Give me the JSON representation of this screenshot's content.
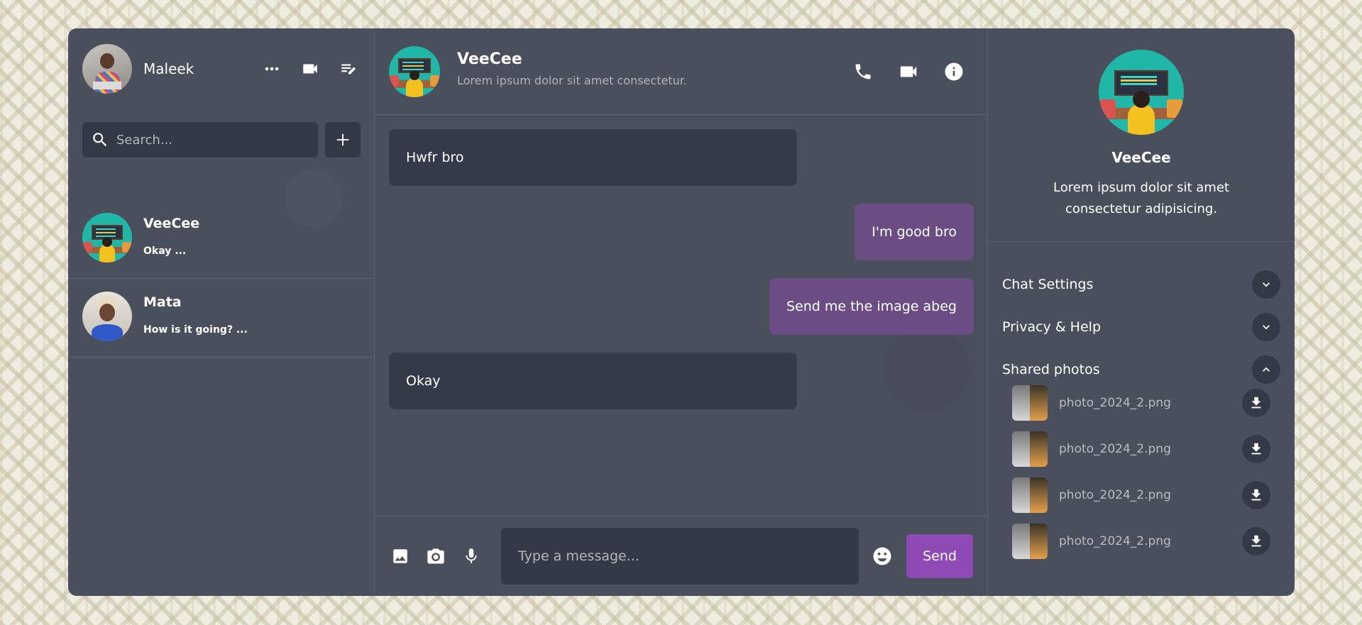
{
  "sidebar": {
    "user": {
      "name": "Maleek",
      "avatar": "maleek-avatar"
    },
    "header_icons": [
      "more-icon",
      "video-icon",
      "edit-icon"
    ],
    "search": {
      "placeholder": "Search...",
      "value": ""
    },
    "conversations": [
      {
        "name": "VeeCee",
        "last_message": "Okay ...",
        "avatar": "veecee-avatar"
      },
      {
        "name": "Mata",
        "last_message": "How is it going? ...",
        "avatar": "mata-avatar"
      }
    ]
  },
  "chat": {
    "title": "VeeCee",
    "status": "Lorem ipsum dolor sit amet consectetur.",
    "action_icons": [
      "phone-icon",
      "video-icon",
      "info-icon"
    ],
    "messages": [
      {
        "text": "Hwfr bro",
        "direction": "received"
      },
      {
        "text": "I'm good bro",
        "direction": "sent"
      },
      {
        "text": "Send me the image abeg",
        "direction": "sent"
      },
      {
        "text": "Okay",
        "direction": "received"
      }
    ],
    "composer": {
      "placeholder": "Type a message...",
      "value": "",
      "send_label": "Send",
      "icons": [
        "image-icon",
        "camera-icon",
        "mic-icon",
        "emoji-icon"
      ]
    }
  },
  "details": {
    "name": "VeeCee",
    "description": "Lorem ipsum dolor sit amet consectetur adipisicing.",
    "options": [
      {
        "label": "Chat Settings",
        "expanded": false
      },
      {
        "label": "Privacy & Help",
        "expanded": false
      },
      {
        "label": "Shared photos",
        "expanded": true
      }
    ],
    "shared_photos": [
      {
        "name": "photo_2024_2.png"
      },
      {
        "name": "photo_2024_2.png"
      },
      {
        "name": "photo_2024_2.png"
      },
      {
        "name": "photo_2024_2.png"
      }
    ]
  },
  "colors": {
    "panel": "#4a4f5c",
    "input_bg": "#343946",
    "sent_bubble": "#6a4e83",
    "received_bubble": "#353a48",
    "accent": "#8e4bb5"
  }
}
